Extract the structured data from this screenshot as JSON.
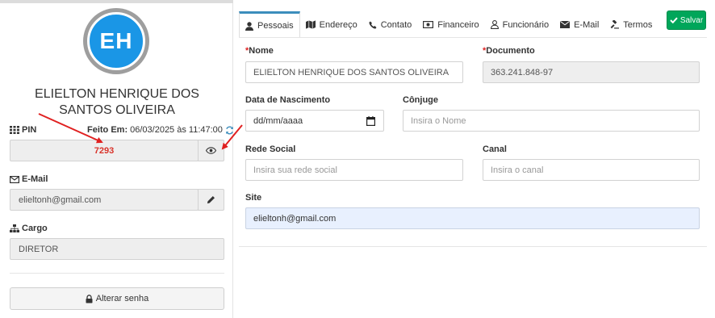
{
  "profile": {
    "initials": "EH",
    "name": "ELIELTON HENRIQUE DOS SANTOS OLIVEIRA",
    "pin_label": "PIN",
    "pin_value": "7293",
    "made_at_label": "Feito Em:",
    "made_at_value": "06/03/2025 às 11:47:00",
    "email_label": "E-Mail",
    "email_value": "elieltonh@gmail.com",
    "role_label": "Cargo",
    "role_value": "DIRETOR",
    "change_password_label": "Alterar senha"
  },
  "tabs": [
    {
      "label": "Pessoais",
      "icon": "user-icon",
      "active": true
    },
    {
      "label": "Endereço",
      "icon": "map-icon",
      "active": false
    },
    {
      "label": "Contato",
      "icon": "phone-icon",
      "active": false
    },
    {
      "label": "Financeiro",
      "icon": "money-icon",
      "active": false
    },
    {
      "label": "Funcionário",
      "icon": "user-outline-icon",
      "active": false
    },
    {
      "label": "E-Mail",
      "icon": "envelope-icon",
      "active": false
    },
    {
      "label": "Termos",
      "icon": "gavel-icon",
      "active": false
    }
  ],
  "save_label": "Salvar",
  "form": {
    "nome_label": "Nome",
    "nome_value": "ELIELTON HENRIQUE DOS SANTOS OLIVEIRA",
    "documento_label": "Documento",
    "documento_value": "363.241.848-97",
    "nascimento_label": "Data de Nascimento",
    "nascimento_placeholder": "dd/mm/aaaa",
    "conjuge_label": "Cônjuge",
    "conjuge_placeholder": "Insira o Nome",
    "rede_label": "Rede Social",
    "rede_placeholder": "Insira sua rede social",
    "canal_label": "Canal",
    "canal_placeholder": "Insira o canal",
    "site_label": "Site",
    "site_value": "elieltonh@gmail.com",
    "required_mark": "*"
  },
  "colors": {
    "accent": "#3c8dbc",
    "avatar": "#1a96e6",
    "save": "#00a65a",
    "pin": "#d9342b",
    "annotation_arrow": "#e02020"
  }
}
